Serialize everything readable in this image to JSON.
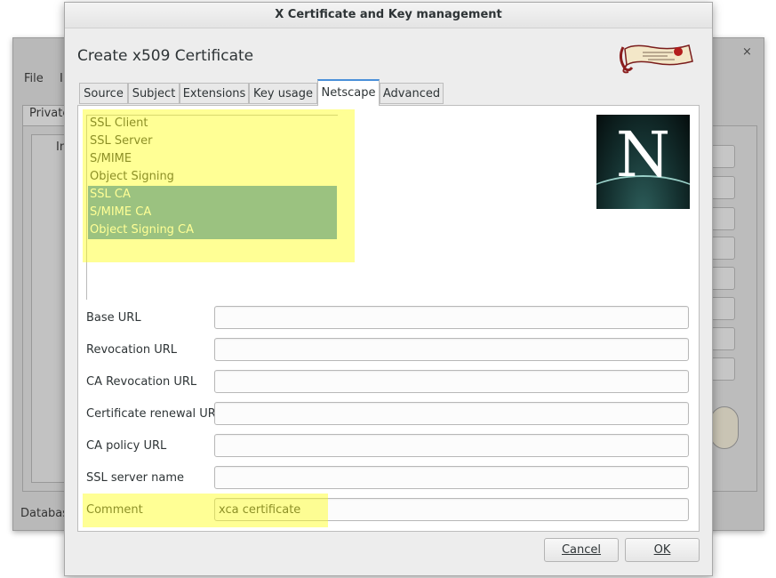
{
  "background_window": {
    "menu_file": "File",
    "menu_partial": "I",
    "tab_private": "Private",
    "column_header": "In",
    "close_glyph": "×",
    "status_partial": "Databas"
  },
  "dialog": {
    "window_title": "X Certificate and Key management",
    "heading": "Create x509 Certificate",
    "tabs": [
      "Source",
      "Subject",
      "Extensions",
      "Key usage",
      "Netscape",
      "Advanced"
    ],
    "active_tab": "Netscape",
    "cert_types": [
      {
        "label": "SSL Client",
        "selected": false
      },
      {
        "label": "SSL Server",
        "selected": false
      },
      {
        "label": "S/MIME",
        "selected": false
      },
      {
        "label": "Object Signing",
        "selected": false
      },
      {
        "label": "SSL CA",
        "selected": true
      },
      {
        "label": "S/MIME CA",
        "selected": true
      },
      {
        "label": "Object Signing CA",
        "selected": true
      }
    ],
    "netscape_logo_letter": "N",
    "fields": {
      "base_url": {
        "label": "Base URL",
        "value": ""
      },
      "revocation_url": {
        "label": "Revocation URL",
        "value": ""
      },
      "ca_revocation_url": {
        "label": "CA Revocation URL",
        "value": ""
      },
      "cert_renewal_url": {
        "label": "Certificate renewal URL",
        "value": ""
      },
      "ca_policy_url": {
        "label": "CA policy URL",
        "value": ""
      },
      "ssl_server_name": {
        "label": "SSL server name",
        "value": ""
      },
      "comment": {
        "label": "Comment",
        "value": "xca certificate"
      }
    },
    "buttons": {
      "cancel_label": "Cancel",
      "ok_label": "OK"
    }
  },
  "colors": {
    "selection": "#4a90d9",
    "highlight": "#ffff14",
    "active_tab_accent": "#4a90d9"
  },
  "icons": [
    "xca-logo-icon",
    "netscape-logo-icon",
    "close-icon"
  ]
}
